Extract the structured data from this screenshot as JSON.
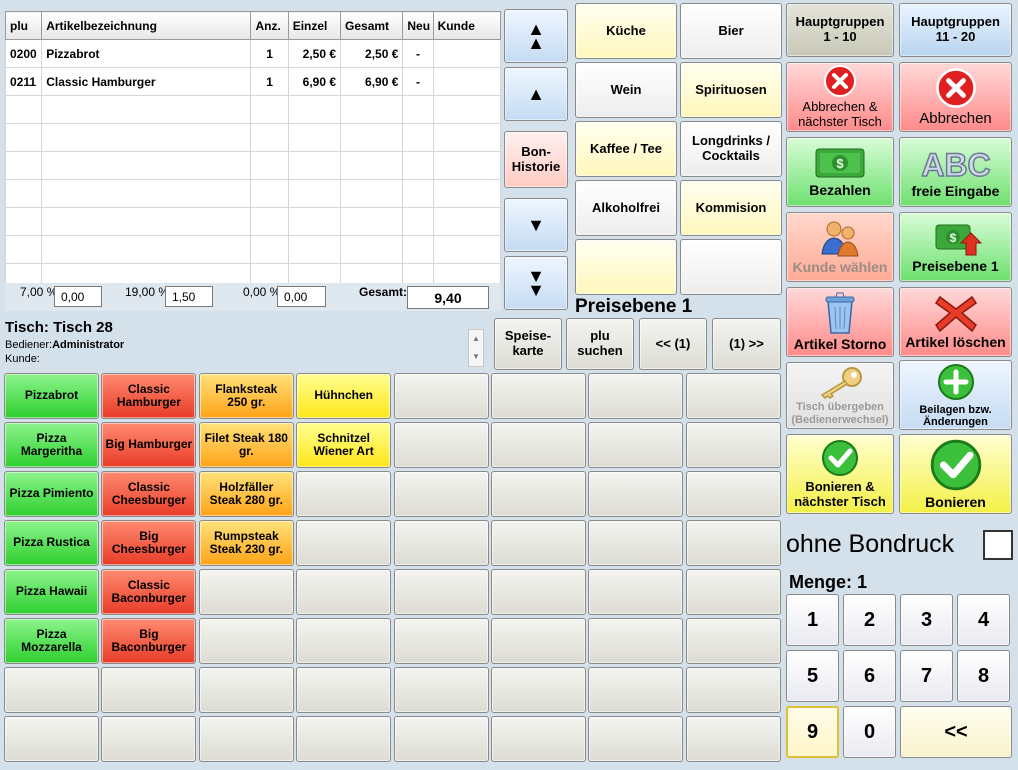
{
  "order": {
    "columns": [
      "plu",
      "Artikelbezeichnung",
      "Anz.",
      "Einzel",
      "Gesamt",
      "Neu",
      "Kunde"
    ],
    "rows": [
      {
        "plu": "0200",
        "name": "Pizzabrot",
        "qty": "1",
        "unit": "2,50 €",
        "total": "2,50 €",
        "new": "-",
        "customer": ""
      },
      {
        "plu": "0211",
        "name": "Classic Hamburger",
        "qty": "1",
        "unit": "6,90 €",
        "total": "6,90 €",
        "new": "-",
        "customer": ""
      }
    ],
    "empty_rows": 7
  },
  "taxes": [
    {
      "label": "7,00 %",
      "value": "0,00"
    },
    {
      "label": "19,00 %",
      "value": "1,50"
    },
    {
      "label": "0,00 %",
      "value": "0,00"
    }
  ],
  "total": {
    "label": "Gesamt:",
    "value": "9,40"
  },
  "scroll": {
    "top": "▲▲",
    "up": "▲",
    "bon": "Bon-\nHistorie",
    "down": "▼",
    "bottom": "▼▼"
  },
  "info": {
    "table": "Tisch: Tisch 28",
    "server_label": "Bediener:",
    "server": "Administrator",
    "customer_label": "Kunde:"
  },
  "nav": {
    "menu": "Speise-\nkarte",
    "plu": "plu\nsuchen",
    "prev": "<< (1)",
    "next": "(1) >>"
  },
  "price_level": "Preisebene 1",
  "categories": [
    {
      "label": "Küche",
      "style": "lightyellow"
    },
    {
      "label": "Bier",
      "style": "white"
    },
    {
      "label": "Wein",
      "style": "white"
    },
    {
      "label": "Spirituosen",
      "style": "lightyellow"
    },
    {
      "label": "Kaffee / Tee",
      "style": "lightyellow"
    },
    {
      "label": "Longdrinks /\nCocktails",
      "style": "white"
    },
    {
      "label": "Alkoholfrei",
      "style": "white"
    },
    {
      "label": "Kommision",
      "style": "lightyellow"
    },
    {
      "label": "",
      "style": "lightyellow"
    },
    {
      "label": "",
      "style": "white"
    }
  ],
  "products": [
    [
      "Pizzabrot",
      "Classic\nHamburger",
      "Flanksteak\n250 gr.",
      "Hühnchen",
      "",
      "",
      "",
      ""
    ],
    [
      "Pizza\nMargeritha",
      "Big Hamburger",
      "Filet Steak 180\ngr.",
      "Schnitzel\nWiener Art",
      "",
      "",
      "",
      ""
    ],
    [
      "Pizza Pimiento",
      "Classic\nCheesburger",
      "Holzfäller\nSteak 280 gr.",
      "",
      "",
      "",
      "",
      ""
    ],
    [
      "Pizza Rustica",
      "Big\nCheesburger",
      "Rumpsteak\nSteak 230 gr.",
      "",
      "",
      "",
      "",
      ""
    ],
    [
      "Pizza Hawaii",
      "Classic\nBaconburger",
      "",
      "",
      "",
      "",
      "",
      ""
    ],
    [
      "Pizza\nMozzarella",
      "Big\nBaconburger",
      "",
      "",
      "",
      "",
      "",
      ""
    ],
    [
      "",
      "",
      "",
      "",
      "",
      "",
      "",
      ""
    ],
    [
      "",
      "",
      "",
      "",
      "",
      "",
      "",
      ""
    ]
  ],
  "product_colors": [
    "green",
    "red",
    "orange",
    "yellow",
    "grey",
    "grey",
    "grey",
    "grey"
  ],
  "functions": {
    "hg1": "Hauptgruppen\n1 - 10",
    "hg2": "Hauptgruppen\n11 - 20",
    "cancel_next": "Abbrechen &\nnächster Tisch",
    "cancel": "Abbrechen",
    "pay": "Bezahlen",
    "free": "freie Eingabe",
    "customer": "Kunde wählen",
    "price_level": "Preisebene 1",
    "storno": "Artikel Storno",
    "delete": "Artikel löschen",
    "handover": "Tisch übergeben\n(Bedienerwechsel)",
    "sides": "Beilagen bzw.\nÄnderungen",
    "book_next": "Bonieren &\nnächster Tisch",
    "book": "Bonieren"
  },
  "no_print": "ohne Bondruck",
  "quantity": "Menge: 1",
  "numpad": [
    "1",
    "2",
    "3",
    "4",
    "5",
    "6",
    "7",
    "8",
    "9",
    "0",
    "<<"
  ],
  "colors": {
    "green": "#2fcf2f",
    "red": "#e83c28",
    "orange": "#ffa318",
    "yellow": "#ffe61a",
    "background": "#d4e0ea"
  }
}
